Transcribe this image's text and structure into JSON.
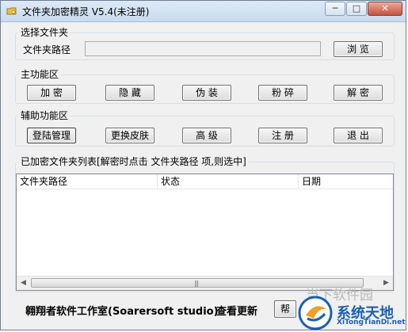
{
  "window": {
    "title": "文件夹加密精灵 V5.4(未注册)",
    "controls": {
      "minimize": "─",
      "maximize": "□",
      "close": "✕"
    }
  },
  "folder_group": {
    "legend": "选择文件夹",
    "path_label": "文件夹路径",
    "path_value": "",
    "browse_label": "浏 览"
  },
  "main_group": {
    "legend": "主功能区",
    "buttons": [
      "加 密",
      "隐 藏",
      "伪 装",
      "粉 碎",
      "解 密"
    ]
  },
  "aux_group": {
    "legend": "辅助功能区",
    "buttons": [
      "登陆管理",
      "更换皮肤",
      "高 级",
      "注 册",
      "退 出"
    ]
  },
  "list_group": {
    "legend": "已加密文件夹列表[解密时点击 文件夹路径 项,则选中]",
    "columns": [
      "文件夹路径",
      "状态",
      "日期"
    ],
    "rows": []
  },
  "footer": {
    "studio": "翱翔者软件工作室(Soarersoft studio)",
    "update": "查看更新",
    "help": "帮"
  },
  "watermark": {
    "left_text": "当下软件园",
    "brand": "系统天地",
    "brand_url_text": "XiTongTianDi.net"
  },
  "colors": {
    "window_bg": "#f0f0f0",
    "titlebar": "#c9dbee",
    "close_button": "#c7533f",
    "watermark_blue": "#1a5fb4"
  }
}
